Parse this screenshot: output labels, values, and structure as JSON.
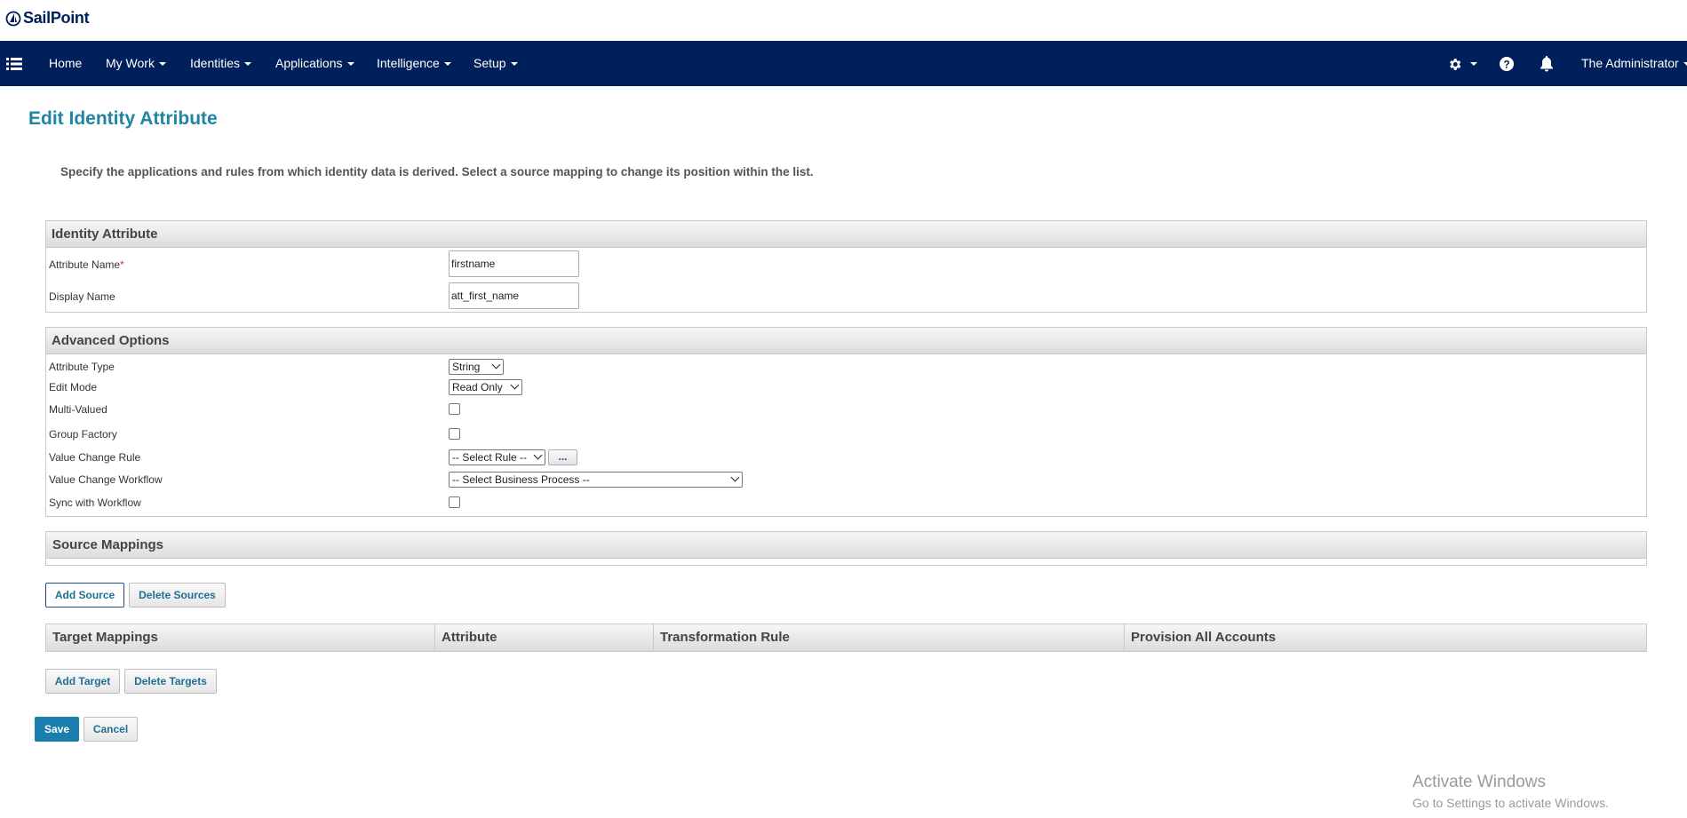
{
  "app": {
    "logo_text": "SailPoint"
  },
  "nav": {
    "menu_icon": "hamburger-list-icon",
    "items": [
      {
        "label": "Home"
      },
      {
        "label": "My Work"
      },
      {
        "label": "Identities"
      },
      {
        "label": "Applications"
      },
      {
        "label": "Intelligence"
      },
      {
        "label": "Setup"
      }
    ],
    "right_icons": [
      "gear-icon",
      "help-icon",
      "bell-icon"
    ],
    "user": "The Administrator"
  },
  "page": {
    "title": "Edit Identity Attribute",
    "instructions": "Specify the applications and rules from which identity data is derived. Select a source mapping to change its position within the list."
  },
  "identity_attribute": {
    "header": "Identity Attribute",
    "attribute_name_label": "Attribute Name",
    "required_mark": "*",
    "attribute_name_value": "firstname",
    "display_name_label": "Display Name",
    "display_name_value": "att_first_name"
  },
  "advanced_options": {
    "header": "Advanced Options",
    "attribute_type_label": "Attribute Type",
    "attribute_type_value": "String",
    "edit_mode_label": "Edit Mode",
    "edit_mode_value": "Read Only",
    "multi_valued_label": "Multi-Valued",
    "group_factory_label": "Group Factory",
    "value_change_rule_label": "Value Change Rule",
    "value_change_rule_value": "-- Select Rule --",
    "ellipsis_button": "...",
    "value_change_workflow_label": "Value Change Workflow",
    "value_change_workflow_value": "-- Select Business Process --",
    "sync_with_workflow_label": "Sync with Workflow"
  },
  "source_mappings": {
    "header": "Source Mappings",
    "add_button": "Add Source",
    "delete_button": "Delete Sources"
  },
  "target_mappings": {
    "columns": [
      "Target Mappings",
      "Attribute",
      "Transformation Rule",
      "Provision All Accounts"
    ],
    "add_button": "Add Target",
    "delete_button": "Delete Targets"
  },
  "actions": {
    "save": "Save",
    "cancel": "Cancel"
  },
  "watermark": {
    "title": "Activate Windows",
    "subtitle": "Go to Settings to activate Windows."
  }
}
